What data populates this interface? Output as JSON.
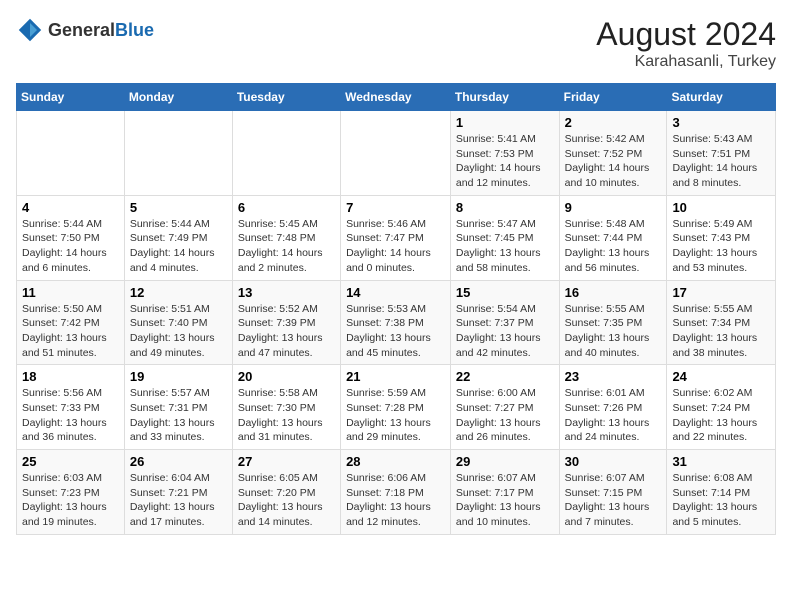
{
  "logo": {
    "text_general": "General",
    "text_blue": "Blue"
  },
  "title": {
    "month_year": "August 2024",
    "location": "Karahasanli, Turkey"
  },
  "days_of_week": [
    "Sunday",
    "Monday",
    "Tuesday",
    "Wednesday",
    "Thursday",
    "Friday",
    "Saturday"
  ],
  "weeks": [
    [
      {
        "day": "",
        "content": ""
      },
      {
        "day": "",
        "content": ""
      },
      {
        "day": "",
        "content": ""
      },
      {
        "day": "",
        "content": ""
      },
      {
        "day": "1",
        "content": "Sunrise: 5:41 AM\nSunset: 7:53 PM\nDaylight: 14 hours\nand 12 minutes."
      },
      {
        "day": "2",
        "content": "Sunrise: 5:42 AM\nSunset: 7:52 PM\nDaylight: 14 hours\nand 10 minutes."
      },
      {
        "day": "3",
        "content": "Sunrise: 5:43 AM\nSunset: 7:51 PM\nDaylight: 14 hours\nand 8 minutes."
      }
    ],
    [
      {
        "day": "4",
        "content": "Sunrise: 5:44 AM\nSunset: 7:50 PM\nDaylight: 14 hours\nand 6 minutes."
      },
      {
        "day": "5",
        "content": "Sunrise: 5:44 AM\nSunset: 7:49 PM\nDaylight: 14 hours\nand 4 minutes."
      },
      {
        "day": "6",
        "content": "Sunrise: 5:45 AM\nSunset: 7:48 PM\nDaylight: 14 hours\nand 2 minutes."
      },
      {
        "day": "7",
        "content": "Sunrise: 5:46 AM\nSunset: 7:47 PM\nDaylight: 14 hours\nand 0 minutes."
      },
      {
        "day": "8",
        "content": "Sunrise: 5:47 AM\nSunset: 7:45 PM\nDaylight: 13 hours\nand 58 minutes."
      },
      {
        "day": "9",
        "content": "Sunrise: 5:48 AM\nSunset: 7:44 PM\nDaylight: 13 hours\nand 56 minutes."
      },
      {
        "day": "10",
        "content": "Sunrise: 5:49 AM\nSunset: 7:43 PM\nDaylight: 13 hours\nand 53 minutes."
      }
    ],
    [
      {
        "day": "11",
        "content": "Sunrise: 5:50 AM\nSunset: 7:42 PM\nDaylight: 13 hours\nand 51 minutes."
      },
      {
        "day": "12",
        "content": "Sunrise: 5:51 AM\nSunset: 7:40 PM\nDaylight: 13 hours\nand 49 minutes."
      },
      {
        "day": "13",
        "content": "Sunrise: 5:52 AM\nSunset: 7:39 PM\nDaylight: 13 hours\nand 47 minutes."
      },
      {
        "day": "14",
        "content": "Sunrise: 5:53 AM\nSunset: 7:38 PM\nDaylight: 13 hours\nand 45 minutes."
      },
      {
        "day": "15",
        "content": "Sunrise: 5:54 AM\nSunset: 7:37 PM\nDaylight: 13 hours\nand 42 minutes."
      },
      {
        "day": "16",
        "content": "Sunrise: 5:55 AM\nSunset: 7:35 PM\nDaylight: 13 hours\nand 40 minutes."
      },
      {
        "day": "17",
        "content": "Sunrise: 5:55 AM\nSunset: 7:34 PM\nDaylight: 13 hours\nand 38 minutes."
      }
    ],
    [
      {
        "day": "18",
        "content": "Sunrise: 5:56 AM\nSunset: 7:33 PM\nDaylight: 13 hours\nand 36 minutes."
      },
      {
        "day": "19",
        "content": "Sunrise: 5:57 AM\nSunset: 7:31 PM\nDaylight: 13 hours\nand 33 minutes."
      },
      {
        "day": "20",
        "content": "Sunrise: 5:58 AM\nSunset: 7:30 PM\nDaylight: 13 hours\nand 31 minutes."
      },
      {
        "day": "21",
        "content": "Sunrise: 5:59 AM\nSunset: 7:28 PM\nDaylight: 13 hours\nand 29 minutes."
      },
      {
        "day": "22",
        "content": "Sunrise: 6:00 AM\nSunset: 7:27 PM\nDaylight: 13 hours\nand 26 minutes."
      },
      {
        "day": "23",
        "content": "Sunrise: 6:01 AM\nSunset: 7:26 PM\nDaylight: 13 hours\nand 24 minutes."
      },
      {
        "day": "24",
        "content": "Sunrise: 6:02 AM\nSunset: 7:24 PM\nDaylight: 13 hours\nand 22 minutes."
      }
    ],
    [
      {
        "day": "25",
        "content": "Sunrise: 6:03 AM\nSunset: 7:23 PM\nDaylight: 13 hours\nand 19 minutes."
      },
      {
        "day": "26",
        "content": "Sunrise: 6:04 AM\nSunset: 7:21 PM\nDaylight: 13 hours\nand 17 minutes."
      },
      {
        "day": "27",
        "content": "Sunrise: 6:05 AM\nSunset: 7:20 PM\nDaylight: 13 hours\nand 14 minutes."
      },
      {
        "day": "28",
        "content": "Sunrise: 6:06 AM\nSunset: 7:18 PM\nDaylight: 13 hours\nand 12 minutes."
      },
      {
        "day": "29",
        "content": "Sunrise: 6:07 AM\nSunset: 7:17 PM\nDaylight: 13 hours\nand 10 minutes."
      },
      {
        "day": "30",
        "content": "Sunrise: 6:07 AM\nSunset: 7:15 PM\nDaylight: 13 hours\nand 7 minutes."
      },
      {
        "day": "31",
        "content": "Sunrise: 6:08 AM\nSunset: 7:14 PM\nDaylight: 13 hours\nand 5 minutes."
      }
    ]
  ]
}
